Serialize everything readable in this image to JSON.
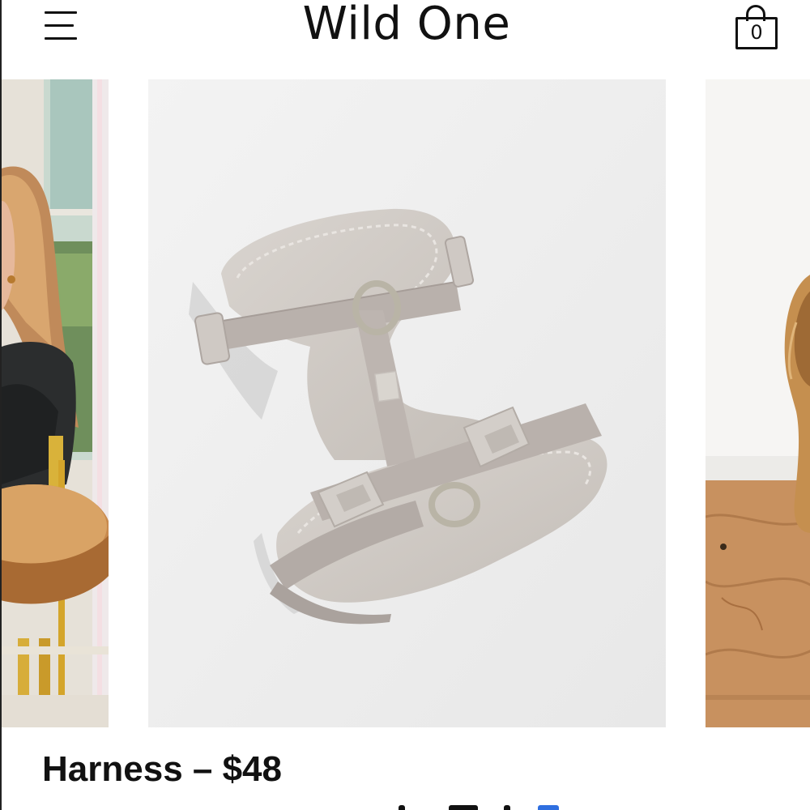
{
  "header": {
    "brand": "Wild One",
    "menu_icon": "hamburger-menu-icon",
    "cart_icon": "shopping-bag-icon",
    "cart_count": "0"
  },
  "carousel": {
    "slides": [
      {
        "id": "lifestyle-person-at-table",
        "position": "previous"
      },
      {
        "id": "harness-product-photo",
        "position": "current"
      },
      {
        "id": "dog-on-wooden-floor",
        "position": "next"
      }
    ]
  },
  "product": {
    "title": "Harness – $48"
  },
  "colors": {
    "background": "#ffffff",
    "text": "#111111",
    "harness": "#c9c3bd",
    "webbing": "#b9b1ac",
    "accent_blue": "#2f6fe0"
  }
}
